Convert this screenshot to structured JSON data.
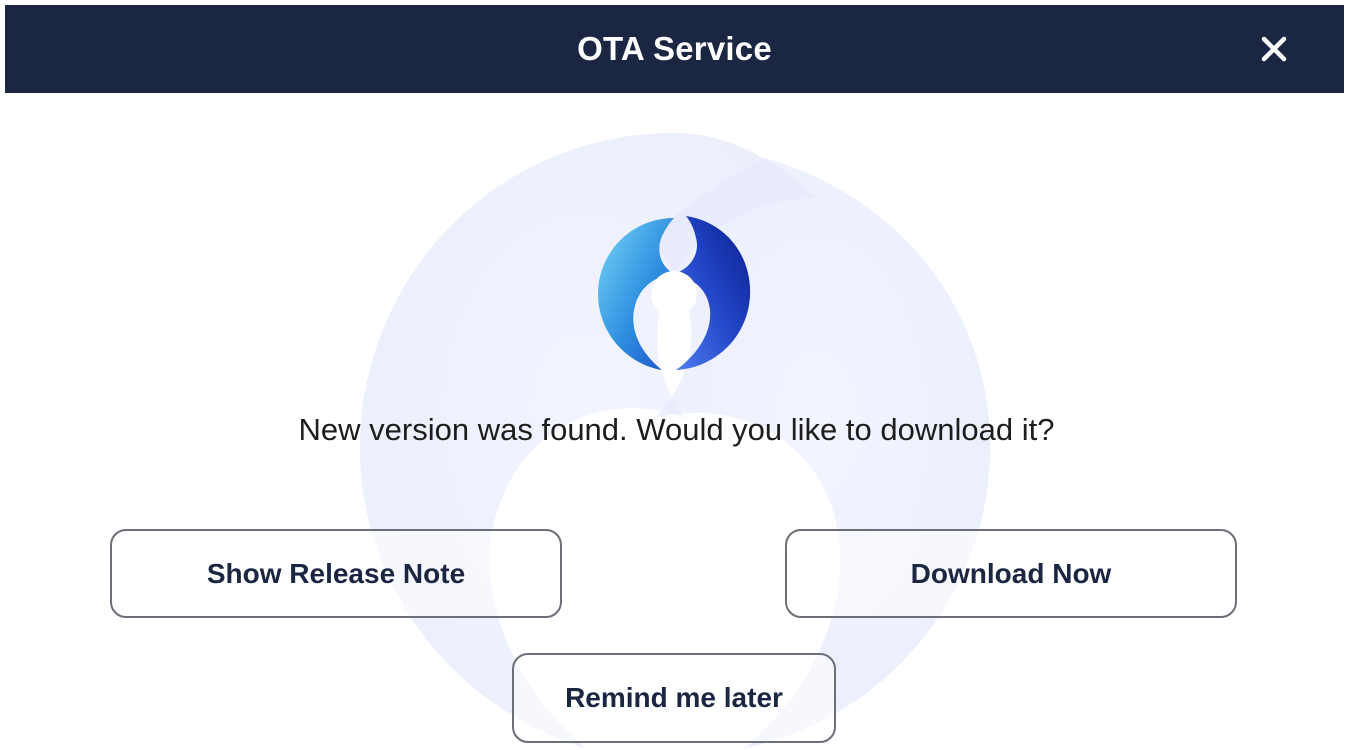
{
  "header": {
    "title": "OTA Service",
    "close_icon": "close-icon"
  },
  "main": {
    "logo_icon": "update-sync-icon",
    "watermark_icon": "update-sync-watermark",
    "message": "New version was found. Would you like to download it?"
  },
  "actions": {
    "show_release_note_label": "Show Release Note",
    "download_now_label": "Download Now",
    "remind_later_label": "Remind me later"
  },
  "colors": {
    "header_background": "#1b2643",
    "button_text": "#1b2643",
    "button_border": "#6b6f78",
    "logo_light": "#5ec8f2",
    "logo_dark": "#1f3fb8"
  }
}
